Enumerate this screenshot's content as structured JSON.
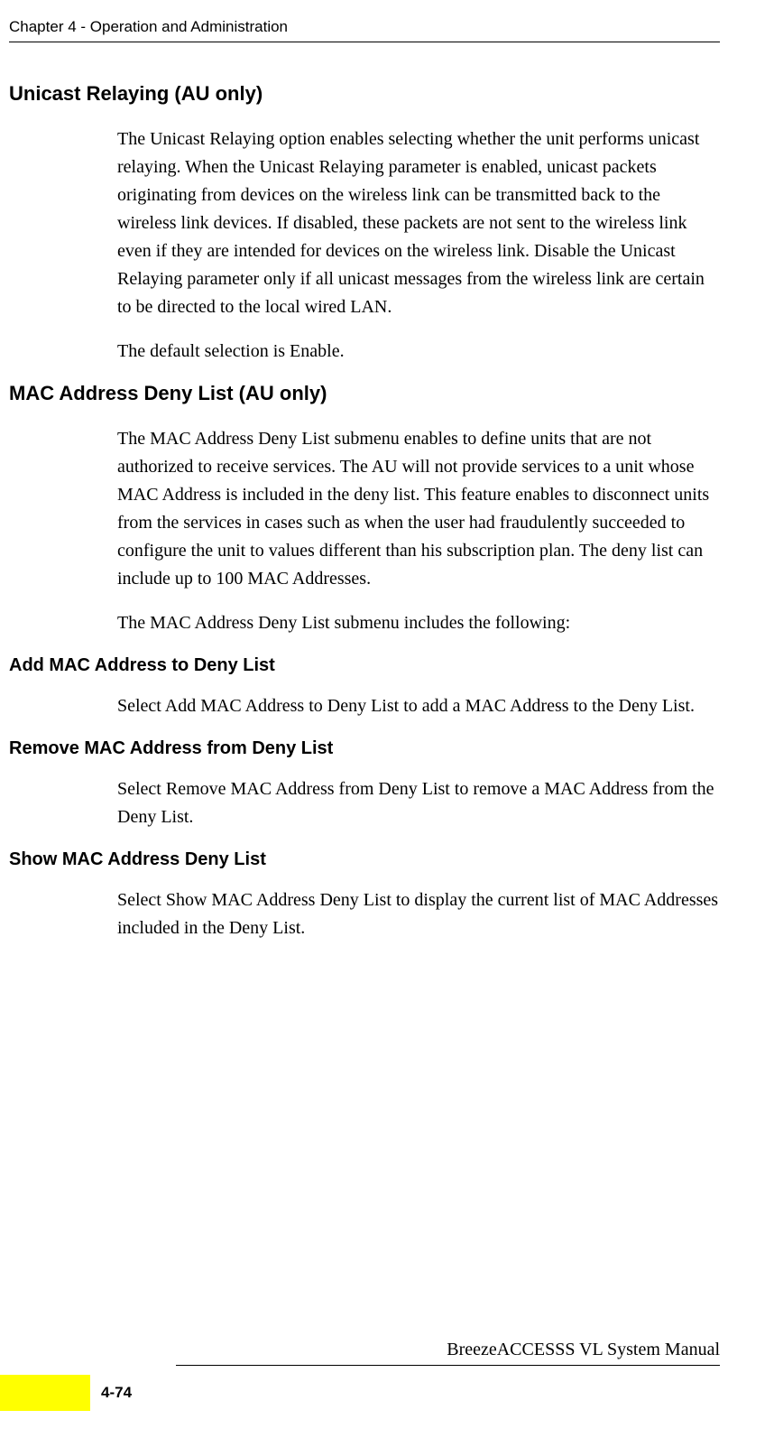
{
  "header": {
    "chapter": "Chapter 4 - Operation and Administration"
  },
  "sections": {
    "s1": {
      "title": "Unicast Relaying (AU only)",
      "p1": "The Unicast Relaying option enables selecting whether the unit performs unicast relaying. When the Unicast Relaying parameter is enabled, unicast packets originating from devices on the wireless link can be transmitted back to the wireless link devices. If disabled, these packets are not sent to the wireless link even if they are intended for devices on the wireless link. Disable the Unicast Relaying parameter only if all unicast messages from the wireless link are certain to be directed to the local wired LAN.",
      "p2": "The default selection is Enable."
    },
    "s2": {
      "title": "MAC Address Deny List (AU only)",
      "p1": "The MAC Address Deny List submenu enables to define units that are not authorized to receive services. The AU will not provide services to a unit whose MAC Address is included in the deny list. This feature enables to disconnect units from the services in cases such as when the user had fraudulently succeeded to configure the unit to values different than his subscription plan. The deny list can include up to 100 MAC Addresses.",
      "p2": "The MAC Address Deny List submenu includes the following:"
    },
    "s3": {
      "title": "Add MAC Address to Deny List",
      "p1": "Select Add MAC Address to Deny List to add a MAC Address to the Deny List."
    },
    "s4": {
      "title": "Remove MAC Address from Deny List",
      "p1": "Select Remove MAC Address from Deny List to remove a MAC Address from the Deny List."
    },
    "s5": {
      "title": "Show MAC Address Deny List",
      "p1": "Select Show MAC Address Deny List to display the current list of MAC Addresses included in the Deny List."
    }
  },
  "footer": {
    "manual_title": "BreezeACCESSS VL System Manual",
    "page_number": "4-74"
  }
}
